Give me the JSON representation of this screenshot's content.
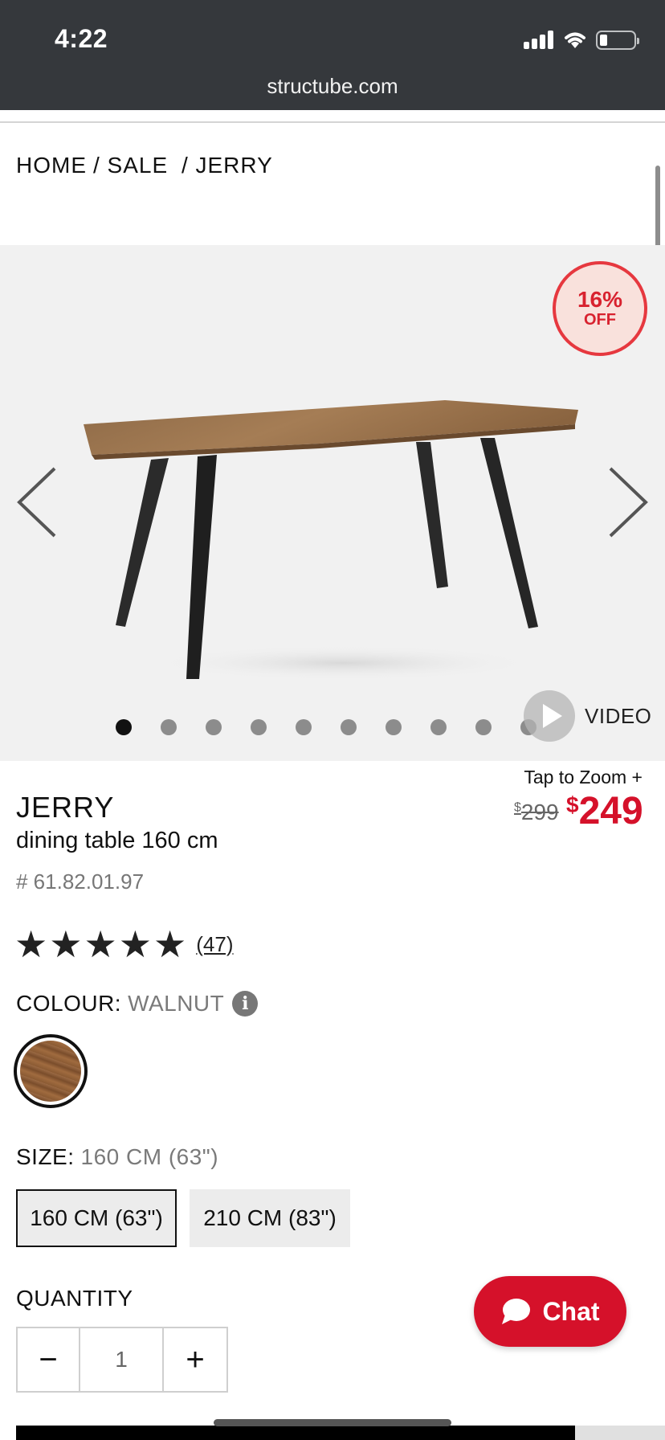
{
  "status_bar": {
    "time": "4:22"
  },
  "browser": {
    "url": "structube.com"
  },
  "breadcrumb": {
    "items": [
      "HOME",
      "/ SALE",
      " / JERRY"
    ]
  },
  "gallery": {
    "badge": {
      "percent": "16%",
      "label": "OFF"
    },
    "dots_count": 10,
    "active_dot": 0,
    "video_label": "VIDEO"
  },
  "product": {
    "tap_zoom": "Tap to Zoom +",
    "name": "JERRY",
    "description": "dining table 160 cm",
    "sku": "# 61.82.01.97",
    "price_old_symbol": "$",
    "price_old": "299",
    "price_new_symbol": "$",
    "price_new": "249",
    "rating_stars": 5,
    "reviews": "(47)"
  },
  "colour": {
    "label": "COLOUR:",
    "value": "WALNUT"
  },
  "size": {
    "label": "SIZE:",
    "value": "160 CM (63\")",
    "options": [
      "160 CM (63\")",
      "210 CM (83\")"
    ]
  },
  "quantity": {
    "label": "QUANTITY",
    "value": "1",
    "minus": "−",
    "plus": "+"
  },
  "chat": {
    "label": "Chat"
  },
  "colors": {
    "accent": "#d5112a",
    "topbar": "#35383c"
  }
}
